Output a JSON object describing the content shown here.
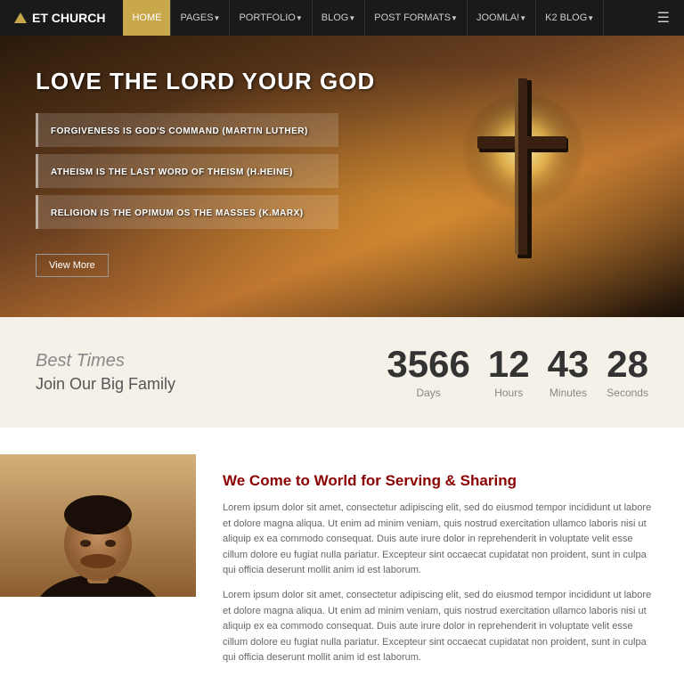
{
  "nav": {
    "logo_text": "ET CHURCH",
    "links": [
      {
        "label": "HOME",
        "active": true
      },
      {
        "label": "PAGES",
        "has_arrow": true
      },
      {
        "label": "PORTFOLIO",
        "has_arrow": true
      },
      {
        "label": "BLOG",
        "has_arrow": true
      },
      {
        "label": "POST FORMATS",
        "has_arrow": true
      },
      {
        "label": "JOOMLA!",
        "has_arrow": true
      },
      {
        "label": "K2 BLOG",
        "has_arrow": true
      }
    ]
  },
  "hero": {
    "title": "LOVE THE LORD YOUR GOD",
    "quotes": [
      "FORGIVENESS IS GOD'S COMMAND (Martin Luther)",
      "ATHEISM IS THE LAST WORD OF THEISM (H.Heine)",
      "RELIGION IS THE OPIMUM OS THE MASSES (K.Marx)"
    ],
    "button_label": "View More"
  },
  "countdown": {
    "heading": "Best Times",
    "subheading": "Join Our Big Family",
    "items": [
      {
        "num": "3566",
        "label": "Days"
      },
      {
        "num": "12",
        "label": "Hours"
      },
      {
        "num": "43",
        "label": "Minutes"
      },
      {
        "num": "28",
        "label": "Seconds"
      }
    ]
  },
  "content": {
    "title": "We Come to World for Serving & Sharing",
    "para1": "Lorem ipsum dolor sit amet, consectetur adipiscing elit, sed do eiusmod tempor incididunt ut labore et dolore magna aliqua. Ut enim ad minim veniam, quis nostrud exercitation ullamco laboris nisi ut aliquip ex ea commodo consequat. Duis aute irure dolor in reprehenderit in voluptate velit esse cillum dolore eu fugiat nulla pariatur. Excepteur sint occaecat cupidatat non proident, sunt in culpa qui officia deserunt mollit anim id est laborum.",
    "para2": "Lorem ipsum dolor sit amet, consectetur adipiscing elit, sed do eiusmod tempor incididunt ut labore et dolore magna aliqua. Ut enim ad minim veniam, quis nostrud exercitation ullamco laboris nisi ut aliquip ex ea commodo consequat. Duis aute irure dolor in reprehenderit in voluptate velit esse cillum dolore eu fugiat nulla pariatur. Excepteur sint occaecat cupidatat non proident, sunt in culpa qui officia deserunt mollit anim id est laborum."
  }
}
